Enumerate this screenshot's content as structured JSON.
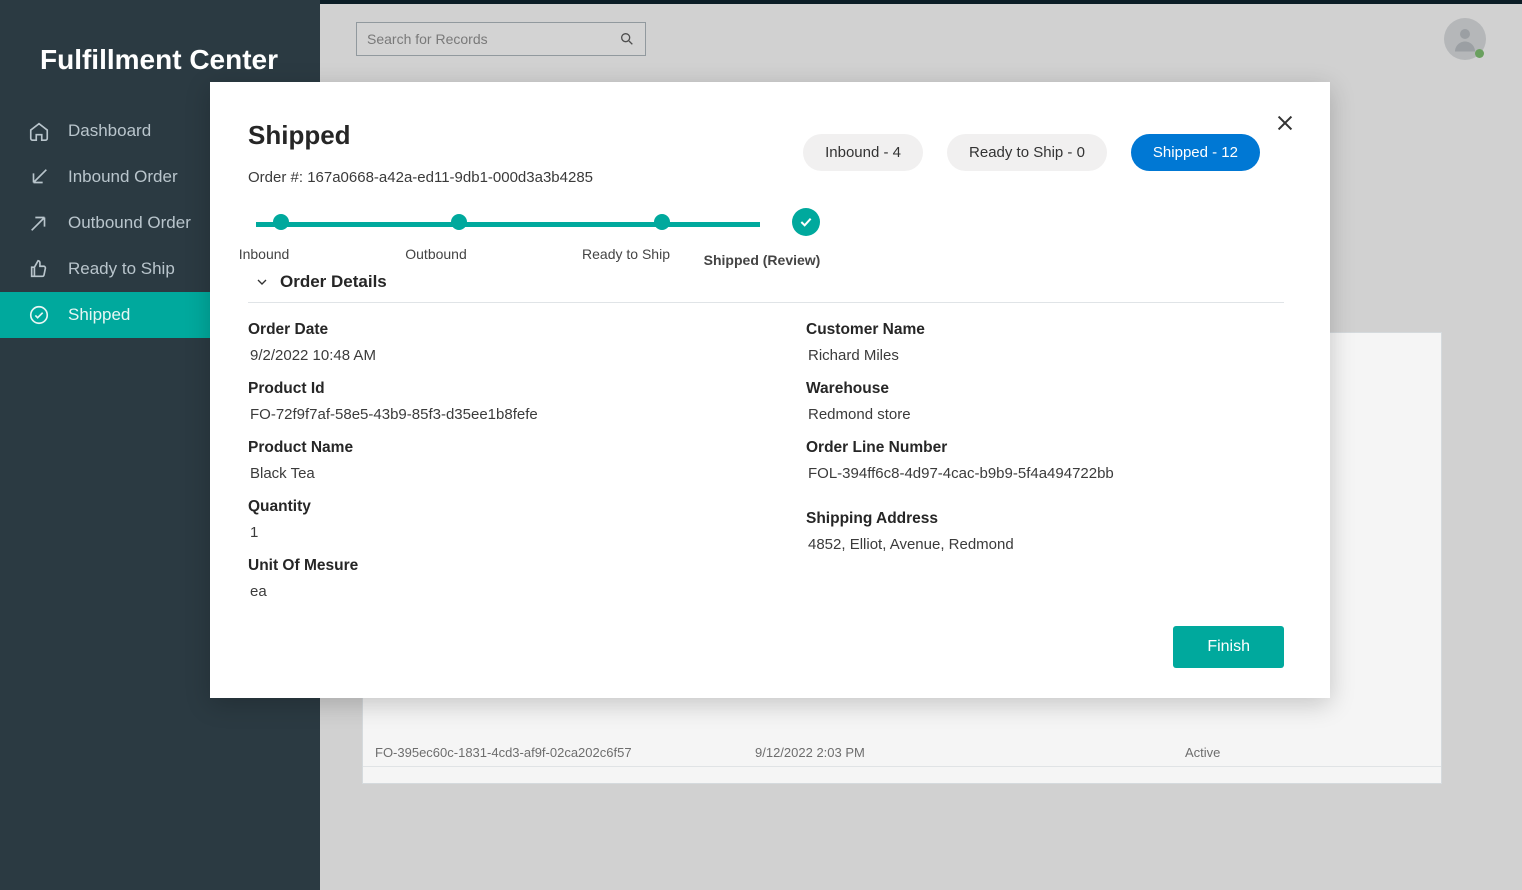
{
  "app": {
    "title": "Fulfillment Center"
  },
  "search": {
    "placeholder": "Search for Records"
  },
  "sidebar": {
    "items": [
      {
        "label": "Dashboard"
      },
      {
        "label": "Inbound Order"
      },
      {
        "label": "Outbound Order"
      },
      {
        "label": "Ready to Ship"
      },
      {
        "label": "Shipped"
      }
    ]
  },
  "modal": {
    "title": "Shipped",
    "order_prefix": "Order #: ",
    "order_number": "167a0668-a42a-ed11-9db1-000d3a3b4285",
    "badges": {
      "inbound": "Inbound - 4",
      "ready": "Ready to Ship - 0",
      "shipped": "Shipped - 12"
    },
    "steps": {
      "s1": "Inbound",
      "s2": "Outbound",
      "s3": "Ready to Ship",
      "s4": "Shipped (Review)"
    },
    "section_title": "Order Details",
    "fields": {
      "order_date_label": "Order Date",
      "order_date_value": "9/2/2022 10:48 AM",
      "product_id_label": "Product Id",
      "product_id_value": "FO-72f9f7af-58e5-43b9-85f3-d35ee1b8fefe",
      "product_name_label": "Product Name",
      "product_name_value": "Black Tea",
      "quantity_label": "Quantity",
      "quantity_value": "1",
      "uom_label": "Unit Of Mesure",
      "uom_value": "ea",
      "customer_label": "Customer Name",
      "customer_value": "Richard Miles",
      "warehouse_label": "Warehouse",
      "warehouse_value": "Redmond store",
      "line_label": "Order Line Number",
      "line_value": "FOL-394ff6c8-4d97-4cac-b9b9-5f4a494722bb",
      "ship_label": "Shipping Address",
      "ship_value": "4852, Elliot, Avenue, Redmond"
    },
    "finish": "Finish"
  },
  "bg_row": {
    "id": "FO-395ec60c-1831-4cd3-af9f-02ca202c6f57",
    "date": "9/12/2022 2:03 PM",
    "status": "Active"
  }
}
